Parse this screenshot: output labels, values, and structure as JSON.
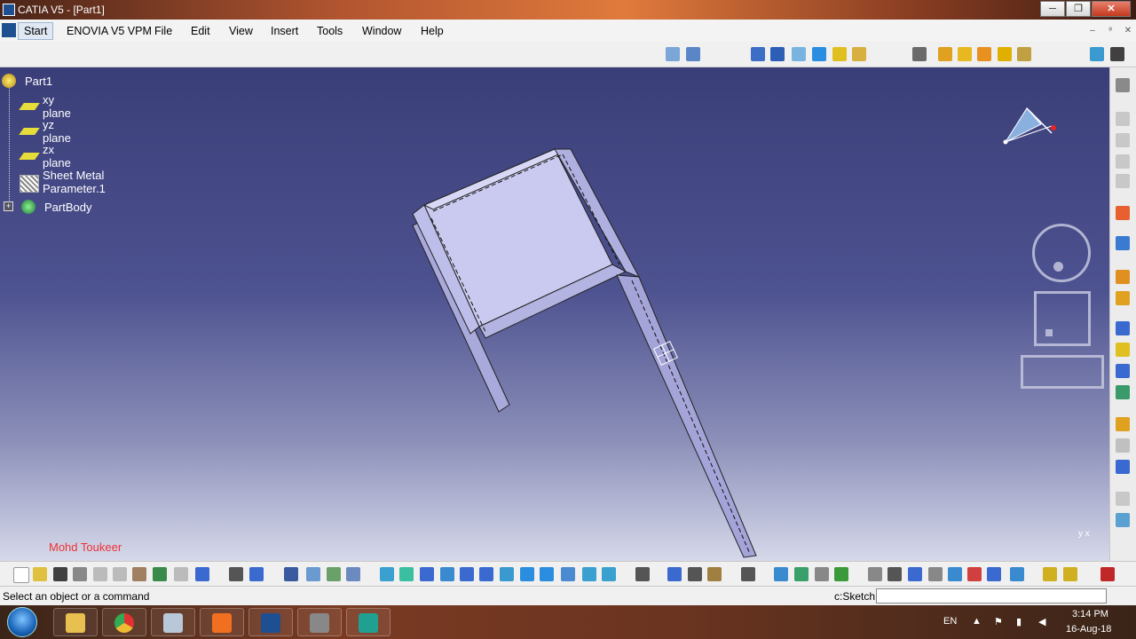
{
  "window": {
    "title": "CATIA V5 - [Part1]",
    "buttons": [
      "─",
      "❐",
      "✕"
    ]
  },
  "menubar": {
    "items": [
      "Start",
      "ENOVIA V5 VPM",
      "File",
      "Edit",
      "View",
      "Insert",
      "Tools",
      "Window",
      "Help"
    ],
    "mdi_buttons": [
      "–",
      "ᵊ",
      "✕"
    ]
  },
  "tree": {
    "root": "Part1",
    "nodes": [
      {
        "label": "xy plane",
        "icon": "plane-icon"
      },
      {
        "label": "yz plane",
        "icon": "plane-icon"
      },
      {
        "label": "zx plane",
        "icon": "plane-icon"
      },
      {
        "label": "Sheet Metal Parameter.1",
        "icon": "sheet-metal-parameter-icon"
      },
      {
        "label": "PartBody",
        "icon": "partbody-icon"
      }
    ]
  },
  "viewport": {
    "author_watermark": "Mohd Toukeer",
    "axis_small": "y x"
  },
  "statusbar": {
    "message": "Select an object or a command",
    "command_label": "c:Sketch",
    "command_value": ""
  },
  "taskbar": {
    "language": "EN",
    "time": "3:14 PM",
    "date": "16-Aug-18"
  },
  "colors": {
    "viewport_top": "#3a3e78",
    "viewport_bottom": "#d6d8ea",
    "part_face": "#c9c9ee",
    "part_side": "#a8a8dc"
  }
}
